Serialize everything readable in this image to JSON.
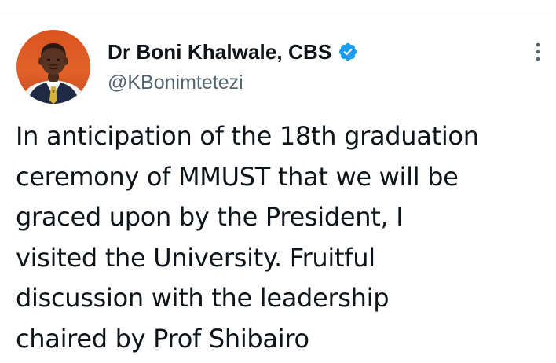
{
  "author": {
    "display_name": "Dr Boni Khalwale, CBS",
    "handle": "@KBonimtetezi",
    "verified": true,
    "avatar_icon": "person-avatar-photo"
  },
  "tweet": {
    "lines": [
      "In anticipation of the 18th graduation",
      "ceremony of MMUST that we will be",
      "graced upon by the President, I",
      "visited the University. Fruitful",
      "discussion with the leadership",
      "chaired by Prof Shibairo"
    ]
  },
  "colors": {
    "text_primary": "#0f1419",
    "text_secondary": "#536471",
    "verified_blue": "#1d9bf0",
    "more_icon": "#536471",
    "divider": "#eff3f4"
  },
  "icons": {
    "verified": "verified-badge-icon",
    "more": "more-options-icon"
  }
}
